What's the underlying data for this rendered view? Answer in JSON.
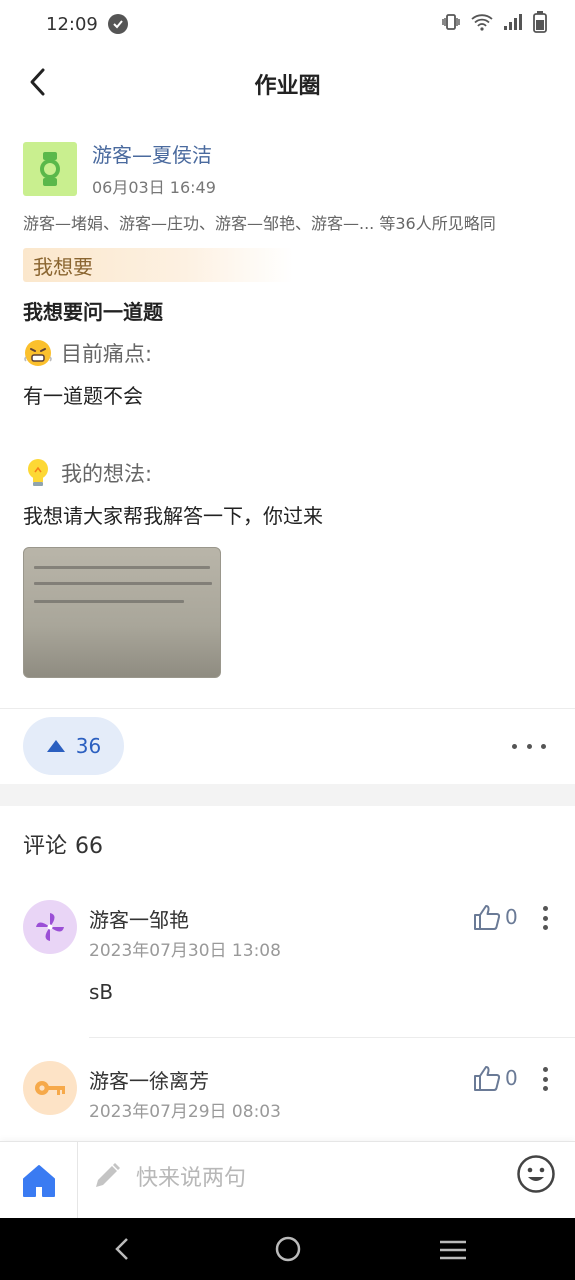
{
  "status_bar": {
    "time": "12:09"
  },
  "header": {
    "title": "作业圈"
  },
  "post": {
    "author_name": "游客—夏侯洁",
    "time": "06月03日 16:49",
    "likers": "游客—堵娟、游客—庄功、游客—邹艳、游客—... 等36人所见略同",
    "tag": "我想要",
    "title": "我想要问一道题",
    "pain_point_heading": "目前痛点:",
    "pain_point_text": "有一道题不会",
    "idea_heading": "我的想法:",
    "idea_text": "我想请大家帮我解答一下，你过来",
    "upvotes": "36"
  },
  "comments_section": {
    "label": "评论",
    "count": "66",
    "items": [
      {
        "name": "游客一邹艳",
        "time": "2023年07月30日 13:08",
        "text": "sB",
        "likes": "0",
        "avatar_color": "#e9d5f6",
        "icon": "pinwheel-icon"
      },
      {
        "name": "游客一徐离芳",
        "time": "2023年07月29日 08:03",
        "text": "",
        "likes": "0",
        "avatar_color": "#fde3c6",
        "icon": "key-icon"
      }
    ]
  },
  "input_bar": {
    "placeholder": "快来说两句"
  },
  "colors": {
    "accent": "#2b5fc0",
    "author": "#4a6a9e",
    "home": "#3a7bf2"
  }
}
